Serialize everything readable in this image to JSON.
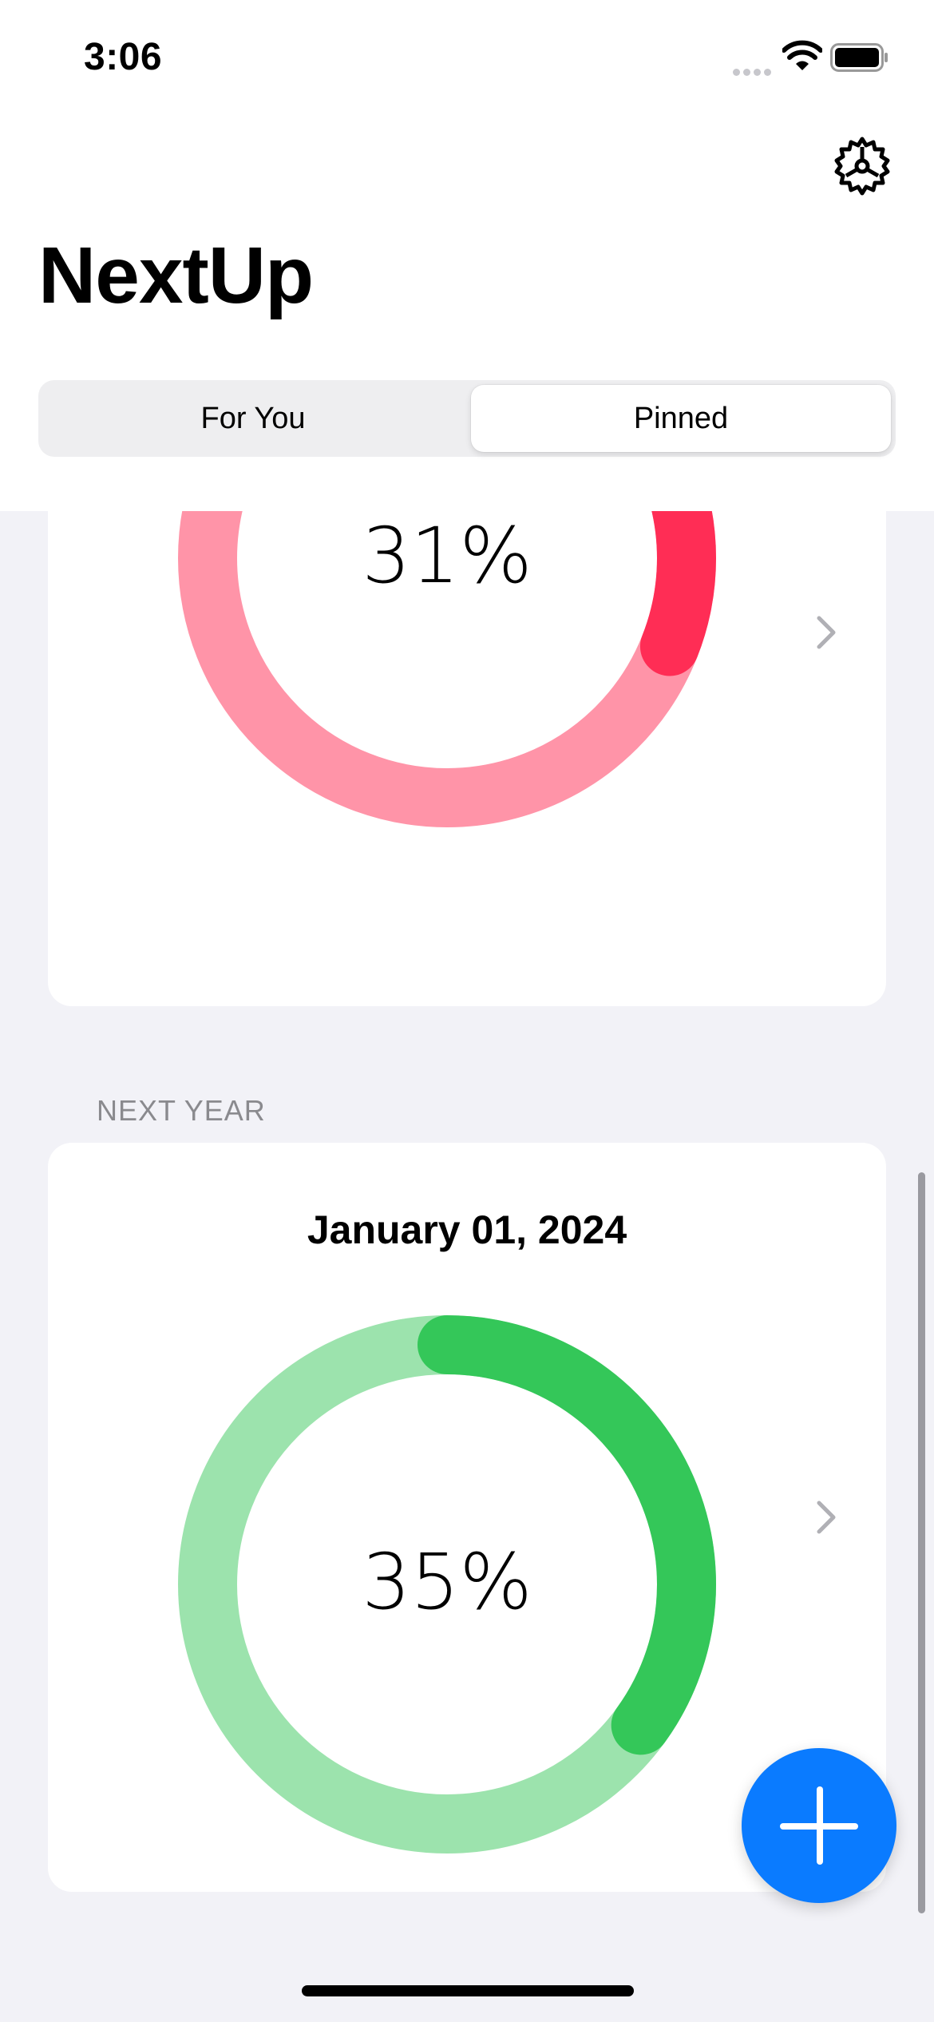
{
  "status_bar": {
    "time": "3:06"
  },
  "app": {
    "title": "NextUp"
  },
  "tabs": [
    {
      "label": "For You",
      "selected": false
    },
    {
      "label": "Pinned",
      "selected": true
    }
  ],
  "cards": [
    {
      "section": "",
      "date": "",
      "percent_label": "31%",
      "progress": 0.31,
      "colors": {
        "track": "#ff94a8",
        "fill": "#ff2d55"
      }
    },
    {
      "section": "NEXT YEAR",
      "date": "January 01, 2024",
      "percent_label": "35%",
      "progress": 0.35,
      "colors": {
        "track": "#9ce3ad",
        "fill": "#34c759"
      }
    }
  ],
  "icons": {
    "settings": "gear-icon",
    "disclosure": "chevron-right-icon",
    "add": "plus-icon"
  },
  "colors": {
    "accent": "#0a7bff",
    "background": "#f2f2f7"
  }
}
